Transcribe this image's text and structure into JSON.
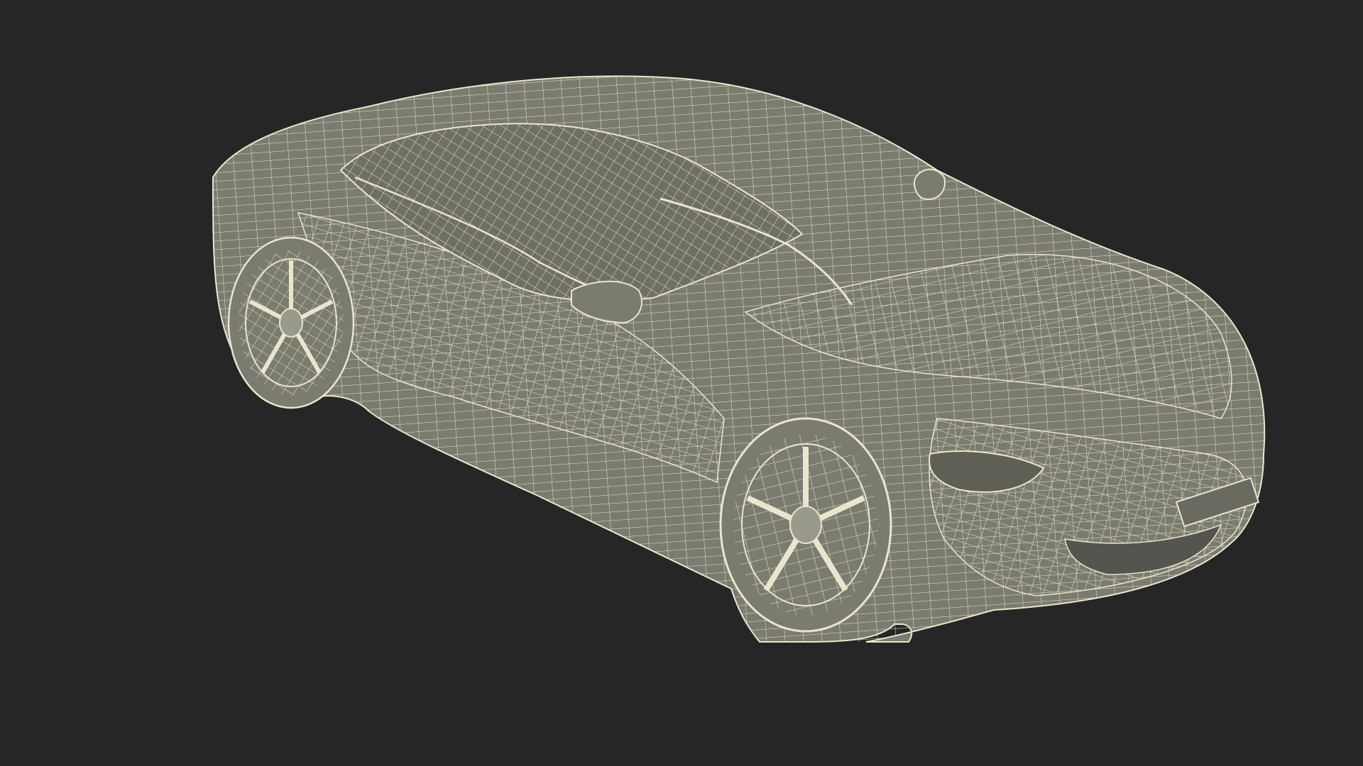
{
  "scene": {
    "subject": "sports-car-wireframe",
    "colors": {
      "background": "#262626",
      "surface": "#7b7b6f",
      "surface_dark": "#5f5f55",
      "wire": "#e9e6cf",
      "wire_dim": "#cfcbb3"
    }
  }
}
